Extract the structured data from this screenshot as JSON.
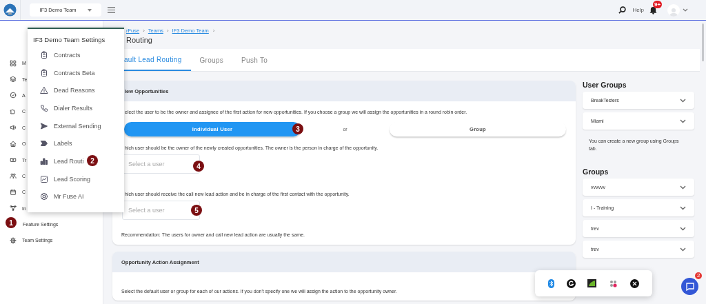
{
  "topbar": {
    "team_select": "IF3 Demo Team",
    "help": "Help",
    "notifications_badge": "9+"
  },
  "sidebar": {
    "items": [
      {
        "label": "M"
      },
      {
        "label": "Te"
      },
      {
        "label": "A"
      },
      {
        "label": "C"
      },
      {
        "label": "C"
      },
      {
        "label": "O"
      },
      {
        "label": "Tr"
      },
      {
        "label": "C"
      },
      {
        "label": "C"
      },
      {
        "label": "In"
      },
      {
        "label": "Feature Settings"
      },
      {
        "label": "Team Settings"
      }
    ]
  },
  "settings_menu": {
    "title": "IF3 Demo Team Settings",
    "items": [
      {
        "label": "Contracts"
      },
      {
        "label": "Contracts Beta"
      },
      {
        "label": "Dead Reasons"
      },
      {
        "label": "Dialer Results"
      },
      {
        "label": "External Sending"
      },
      {
        "label": "Labels"
      },
      {
        "label": "Lead Routi"
      },
      {
        "label": "Lead Scoring"
      },
      {
        "label": "Mr Fuse AI"
      }
    ]
  },
  "breadcrumbs": [
    {
      "label": "rFuse",
      "separator": "›"
    },
    {
      "label": "Teams",
      "separator": "›"
    },
    {
      "label": "IF3 Demo Team",
      "separator": "›"
    }
  ],
  "page_title": "Routing",
  "tabs": [
    {
      "label": "ault Lead Routing",
      "selected": true
    },
    {
      "label": "Groups",
      "selected": false
    },
    {
      "label": "Push To",
      "selected": false
    }
  ],
  "new_opportunities": {
    "title": "lew Opportunities",
    "intro": "elect the user to be the owner and assignee of the first action for new opportunities. If you choose a group we will assign the opportunities in a round robin order.",
    "choices": [
      {
        "label": "Individual User",
        "selected": true
      },
      {
        "label": "Group",
        "selected": false
      }
    ],
    "or": "or",
    "owner_prompt": "hich user should be the owner of the newly created opportunities. The owner is the person in charge of the opportunity.",
    "owner_select": {
      "placeholder": "Select a user"
    },
    "call_prompt": "hich user should receive the call new lead action and be in charge of the first contact with the opportunity.",
    "call_select": {
      "placeholder": "Select a user"
    },
    "recommendation": "Recommendation: The users for owner and call new lead action are usually the same."
  },
  "action_assignment": {
    "title": "Opportunity Action Assignment",
    "text": "Select the default user or group for each of our actions. If you don't specify one we will assign the action to the opportunity owner."
  },
  "user_groups": {
    "title": "User Groups",
    "items": [
      "BreakTesters",
      "Miami"
    ],
    "note": "You can create a new group using Groups tab."
  },
  "groups": {
    "title": "Groups",
    "items": [
      "vvvvvv",
      "I - Training",
      "trev",
      "trev"
    ]
  },
  "step_markers": [
    "1",
    "2",
    "3",
    "4",
    "5"
  ],
  "chat": {
    "badge": "2"
  }
}
